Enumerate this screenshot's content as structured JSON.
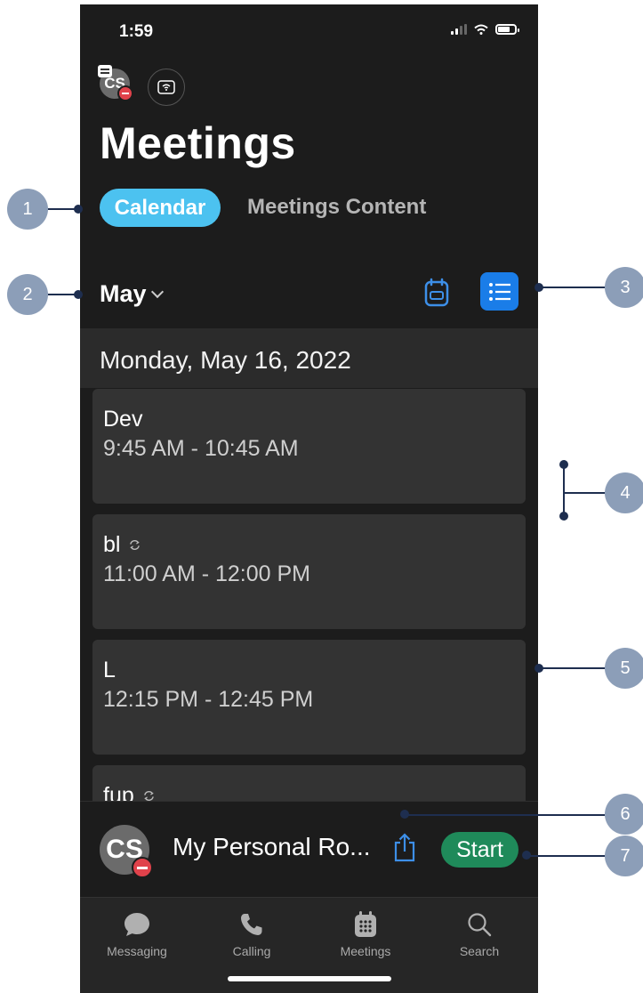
{
  "status_bar": {
    "time": "1:59"
  },
  "header": {
    "avatar_initials": "CS",
    "title": "Meetings"
  },
  "tabs": [
    {
      "label": "Calendar",
      "selected": true
    },
    {
      "label": "Meetings Content",
      "selected": false
    }
  ],
  "month_selector": {
    "label": "May"
  },
  "view_toggle": {
    "active": "list"
  },
  "date_header": "Monday, May 16, 2022",
  "meetings": [
    {
      "title": "Dev",
      "time": "9:45 AM - 10:45 AM",
      "recurring": false
    },
    {
      "title": "bl",
      "time": "11:00 AM - 12:00 PM",
      "recurring": true
    },
    {
      "title": "L",
      "time": "12:15 PM - 12:45 PM",
      "recurring": false
    },
    {
      "title": "fup",
      "time": "",
      "recurring": true
    }
  ],
  "personal_room": {
    "avatar_initials": "CS",
    "name": "My Personal Ro...",
    "start_label": "Start"
  },
  "bottom_nav": [
    {
      "label": "Messaging",
      "icon": "chat-bubble-icon"
    },
    {
      "label": "Calling",
      "icon": "phone-icon"
    },
    {
      "label": "Meetings",
      "icon": "calendar-icon"
    },
    {
      "label": "Search",
      "icon": "search-icon"
    }
  ],
  "callouts": [
    "1",
    "2",
    "3",
    "4",
    "5",
    "6",
    "7"
  ],
  "colors": {
    "background": "#1c1c1c",
    "accent_tab": "#4cc2f0",
    "list_button": "#1a7de8",
    "start_button": "#1f8a5a",
    "presence": "#e0424b",
    "callout_badge": "#8c9eb8"
  }
}
